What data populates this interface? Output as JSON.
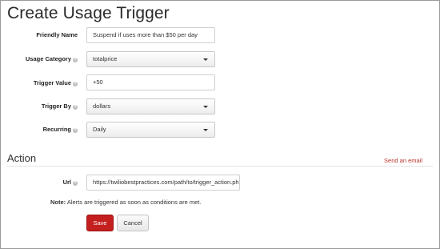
{
  "page": {
    "title": "Create Usage Trigger"
  },
  "form": {
    "friendly_name": {
      "label": "Friendly Name",
      "value": "Suspend if uses more than $50 per day"
    },
    "usage_category": {
      "label": "Usage Category",
      "help_icon": "info-icon",
      "value": "totalprice"
    },
    "trigger_value": {
      "label": "Trigger Value",
      "help_icon": "info-icon",
      "value": "+50"
    },
    "trigger_by": {
      "label": "Trigger By",
      "help_icon": "info-icon",
      "value": "dollars"
    },
    "recurring": {
      "label": "Recurring",
      "help_icon": "info-icon",
      "value": "Daily"
    }
  },
  "action": {
    "title": "Action",
    "send_email_link": "Send an email",
    "url": {
      "label": "Url",
      "help_icon": "info-icon",
      "value": "https://twiliobestpractices.com/path/to/trigger_action.php"
    },
    "note_label": "Note:",
    "note_text": "Alerts are triggered as soon as conditions are met."
  },
  "buttons": {
    "save": "Save",
    "cancel": "Cancel"
  },
  "colors": {
    "primary_button": "#c41f1f",
    "link": "#b8322a"
  }
}
